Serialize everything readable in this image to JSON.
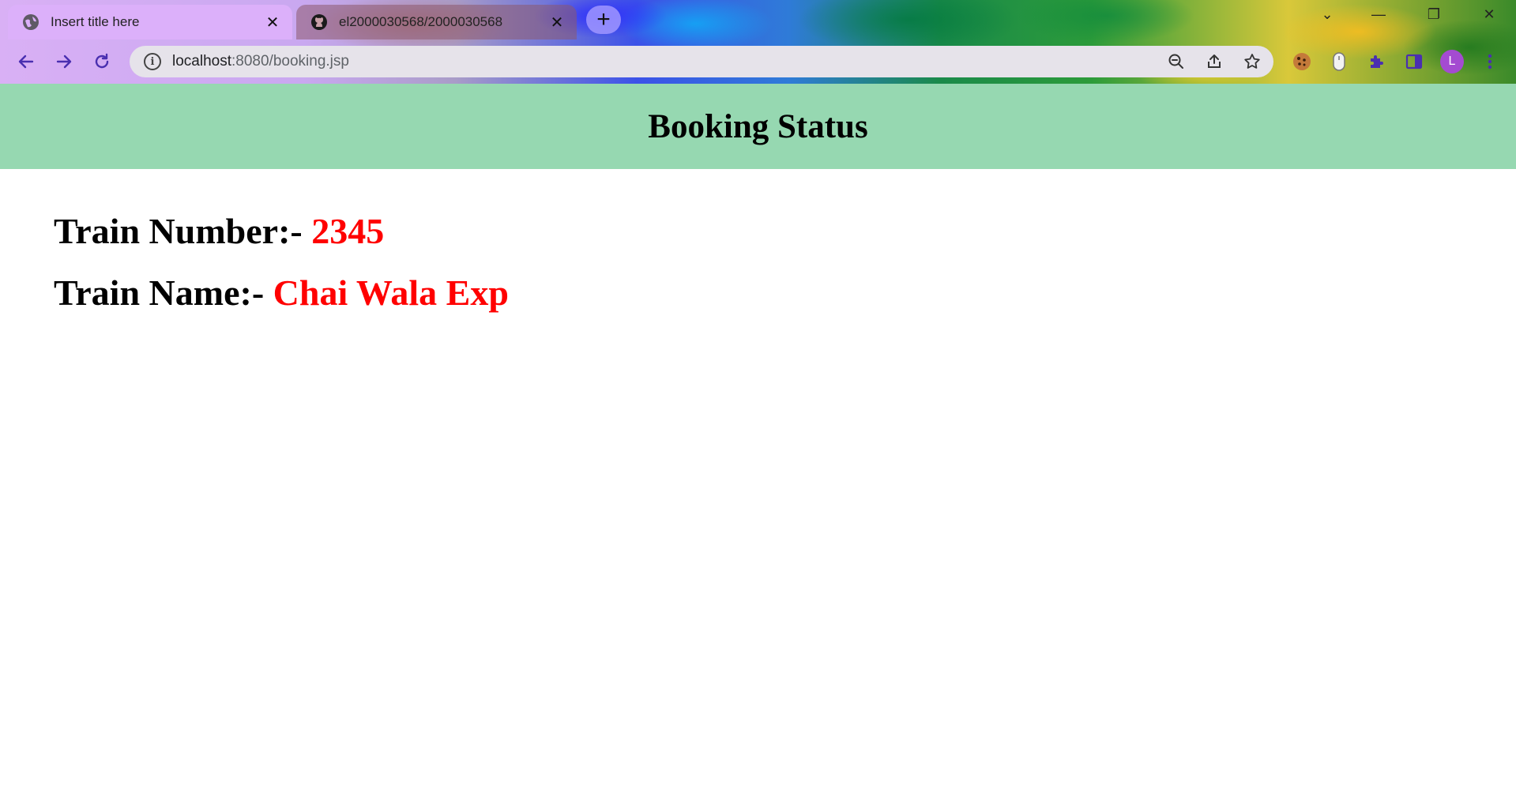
{
  "browser": {
    "tabs": [
      {
        "title": "Insert title here",
        "icon": "globe-icon",
        "active": true
      },
      {
        "title": "el2000030568/2000030568",
        "icon": "github-icon",
        "active": false
      }
    ],
    "new_tab_symbol": "+",
    "url_host": "localhost",
    "url_rest": ":8080/booking.jsp",
    "profile_initial": "L",
    "accent_color": "#dcb0fa"
  },
  "page": {
    "header_title": "Booking Status",
    "header_bg": "#96d8b1",
    "train_number_label": "Train Number:-",
    "train_number_value": "2345",
    "train_name_label": "Train Name:-",
    "train_name_value": "Chai Wala Exp",
    "value_color": "#ff0000"
  }
}
